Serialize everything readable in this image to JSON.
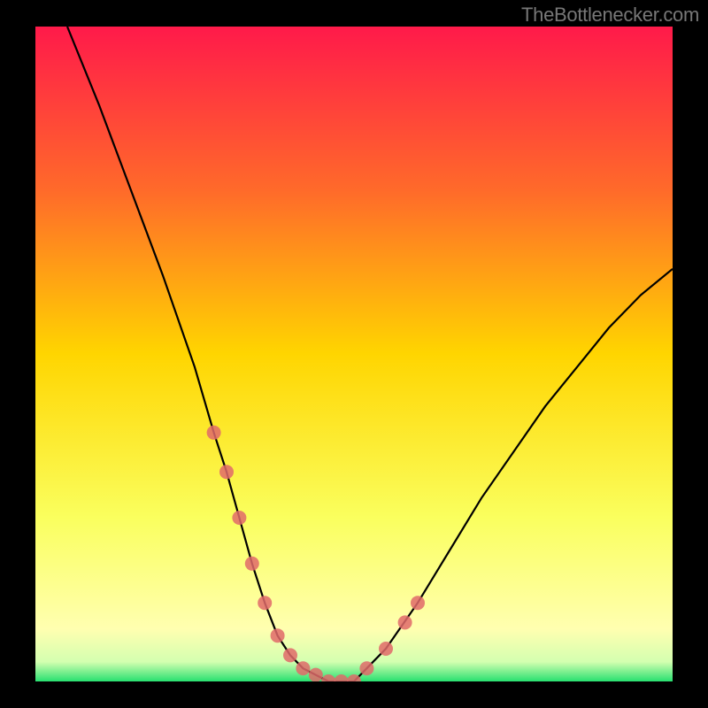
{
  "watermark": "TheBottlenecker.com",
  "chart_data": {
    "type": "line",
    "title": "",
    "xlabel": "",
    "ylabel": "",
    "xlim": [
      0,
      100
    ],
    "ylim": [
      0,
      100
    ],
    "series": [
      {
        "name": "bottleneck-curve",
        "x": [
          5,
          10,
          15,
          20,
          25,
          28,
          30,
          32,
          34,
          36,
          38,
          40,
          42,
          44,
          46,
          48,
          50,
          52,
          55,
          60,
          65,
          70,
          75,
          80,
          85,
          90,
          95,
          100
        ],
        "values": [
          100,
          88,
          75,
          62,
          48,
          38,
          32,
          25,
          18,
          12,
          7,
          4,
          2,
          1,
          0,
          0,
          0,
          2,
          5,
          12,
          20,
          28,
          35,
          42,
          48,
          54,
          59,
          63
        ]
      }
    ],
    "scatter_points": {
      "name": "data-markers",
      "x": [
        28,
        30,
        32,
        34,
        36,
        38,
        40,
        42,
        44,
        46,
        48,
        50,
        52,
        55,
        58,
        60
      ],
      "values": [
        38,
        32,
        25,
        18,
        12,
        7,
        4,
        2,
        1,
        0,
        0,
        0,
        2,
        5,
        9,
        12
      ]
    },
    "gradient_bands": [
      {
        "stop": 0,
        "color": "#ff1a4a"
      },
      {
        "stop": 25,
        "color": "#ff6a2a"
      },
      {
        "stop": 50,
        "color": "#ffd500"
      },
      {
        "stop": 75,
        "color": "#faff5e"
      },
      {
        "stop": 92,
        "color": "#ffffb0"
      },
      {
        "stop": 97,
        "color": "#d4ffb0"
      },
      {
        "stop": 100,
        "color": "#28e070"
      }
    ]
  }
}
